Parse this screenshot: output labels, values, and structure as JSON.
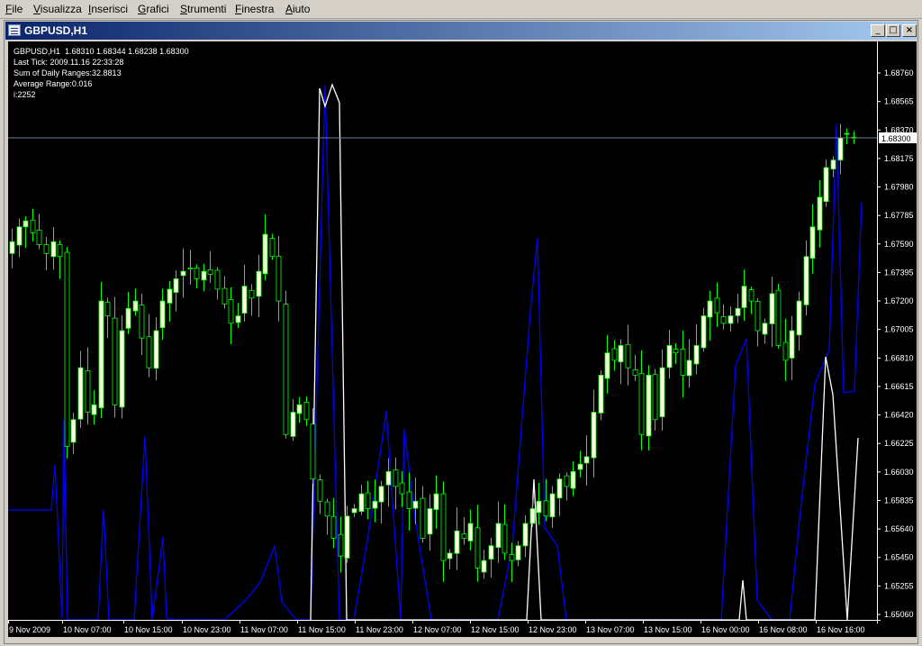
{
  "menu": {
    "items": [
      "File",
      "Visualizza",
      "Inserisci",
      "Grafici",
      "Strumenti",
      "Finestra",
      "Aiuto"
    ]
  },
  "window": {
    "title": "GBPUSD,H1",
    "controls": {
      "minimize": "_",
      "maximize": "□",
      "close": "×"
    }
  },
  "info_panel": {
    "symbol_line": "GBPUSD,H1  1.68310 1.68344 1.68238 1.68300",
    "last_tick": "Last Tick: 2009.11.16 22:33:28",
    "sum_ranges": "Sum of Daily Ranges:32.8813",
    "avg_range": "Average Range:0.016",
    "index": "i:2252"
  },
  "colors": {
    "background": "#000000",
    "bull_candle": "#ffffe0",
    "bear_candle": "#000000",
    "wick": "#00ff00",
    "line_primary": "#0000ff",
    "line_secondary": "#ffffff",
    "axis": "#ffffff",
    "price_line": "#708090"
  },
  "chart_data": {
    "type": "candlestick",
    "current_price": 1.683,
    "current_price_label": "1.68300",
    "ylim": [
      1.6505,
      1.6895
    ],
    "y_ticks": [
      "1.68760",
      "1.68565",
      "1.68370",
      "1.68175",
      "1.67980",
      "1.67785",
      "1.67590",
      "1.67395",
      "1.67200",
      "1.67005",
      "1.66810",
      "1.66615",
      "1.66420",
      "1.66225",
      "1.66030",
      "1.65835",
      "1.65640",
      "1.65450",
      "1.65255",
      "1.65060"
    ],
    "x_labels": [
      "9 Nov 2009",
      "10 Nov 07:00",
      "10 Nov 15:00",
      "10 Nov 23:00",
      "11 Nov 07:00",
      "11 Nov 15:00",
      "11 Nov 23:00",
      "12 Nov 07:00",
      "12 Nov 15:00",
      "12 Nov 23:00",
      "13 Nov 07:00",
      "13 Nov 15:00",
      "16 Nov 00:00",
      "16 Nov 08:00",
      "16 Nov 16:00"
    ],
    "close": [
      1.676,
      1.677,
      1.6774,
      1.6766,
      1.6758,
      1.6752,
      1.676,
      1.675,
      1.6622,
      1.664,
      1.6675,
      1.6645,
      1.665,
      1.672,
      1.671,
      1.665,
      1.67,
      1.6715,
      1.672,
      1.6695,
      1.6675,
      1.67,
      1.672,
      1.6728,
      1.6735,
      1.674,
      1.6742,
      1.6735,
      1.674,
      1.6738,
      1.6728,
      1.6718,
      1.6705,
      1.671,
      1.673,
      1.6722,
      1.674,
      1.6765,
      1.675,
      1.672,
      1.663,
      1.6645,
      1.665,
      1.664,
      1.66,
      1.6585,
      1.6575,
      1.656,
      1.6548,
      1.6575,
      1.658,
      1.659,
      1.658,
      1.6585,
      1.6595,
      1.6605,
      1.6595,
      1.659,
      1.658,
      1.6585,
      1.656,
      1.658,
      1.659,
      1.6545,
      1.655,
      1.6565,
      1.656,
      1.657,
      1.654,
      1.6545,
      1.6555,
      1.657,
      1.655,
      1.6545,
      1.6555,
      1.657,
      1.658,
      1.6585,
      1.6575,
      1.659,
      1.66,
      1.6595,
      1.6605,
      1.661,
      1.6615,
      1.6645,
      1.667,
      1.6685,
      1.668,
      1.669,
      1.6675,
      1.667,
      1.663,
      1.667,
      1.664,
      1.6675,
      1.669,
      1.6685,
      1.667,
      1.668,
      1.669,
      1.671,
      1.672,
      1.6712,
      1.6705,
      1.671,
      1.6715,
      1.673,
      1.672,
      1.67,
      1.6705,
      1.6725,
      1.669,
      1.668,
      1.67,
      1.672,
      1.675,
      1.677,
      1.679,
      1.681,
      1.6815,
      1.683,
      1.6833,
      1.683
    ]
  }
}
